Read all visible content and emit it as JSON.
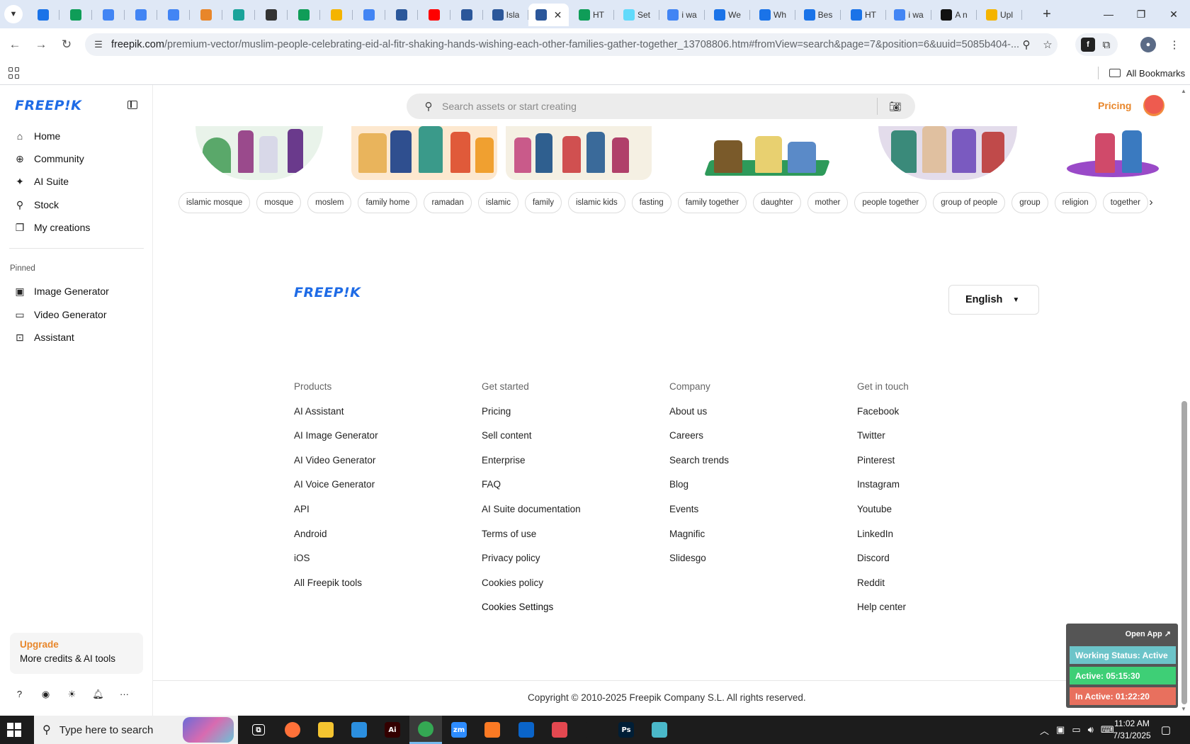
{
  "browser": {
    "tabs": [
      {
        "title": "",
        "color": "#1a73e8"
      },
      {
        "title": "",
        "color": "#0f9d58"
      },
      {
        "title": "",
        "color": "#4285f4"
      },
      {
        "title": "",
        "color": "#4285f4"
      },
      {
        "title": "",
        "color": "#4285f4"
      },
      {
        "title": "",
        "color": "#e8862a"
      },
      {
        "title": "",
        "color": "#1aa39a"
      },
      {
        "title": "",
        "color": "#333333"
      },
      {
        "title": "",
        "color": "#0f9d58"
      },
      {
        "title": "",
        "color": "#f4b400"
      },
      {
        "title": "",
        "color": "#4285f4"
      },
      {
        "title": "",
        "color": "#2b579a"
      },
      {
        "title": "",
        "color": "#ff0000"
      },
      {
        "title": "",
        "color": "#2b579a"
      },
      {
        "title": "Isla",
        "color": "#2b579a"
      },
      {
        "title": "",
        "color": "#2b579a",
        "active": true
      },
      {
        "title": "HT",
        "color": "#0f9d58"
      },
      {
        "title": "Set",
        "color": "#61dafb"
      },
      {
        "title": "i wa",
        "color": "#4285f4"
      },
      {
        "title": "We",
        "color": "#1a73e8"
      },
      {
        "title": "Wh",
        "color": "#1a73e8"
      },
      {
        "title": "Bes",
        "color": "#1a73e8"
      },
      {
        "title": "HT",
        "color": "#1a73e8"
      },
      {
        "title": "i wa",
        "color": "#4285f4"
      },
      {
        "title": "A n",
        "color": "#111111"
      },
      {
        "title": "Upl",
        "color": "#f4b400"
      }
    ],
    "url_host": "freepik.com",
    "url_path": "/premium-vector/muslim-people-celebrating-eid-al-fitr-shaking-hands-wishing-each-other-families-gather-together_13708806.htm#fromView=search&page=7&position=6&uuid=5085b404-...",
    "bookmarks_label": "All Bookmarks"
  },
  "sidebar": {
    "logo": "FREEP!K",
    "nav": [
      {
        "label": "Home",
        "icon": "⌂"
      },
      {
        "label": "Community",
        "icon": "⊕"
      },
      {
        "label": "AI Suite",
        "icon": "✦"
      },
      {
        "label": "Stock",
        "icon": "⚲"
      },
      {
        "label": "My creations",
        "icon": "❐"
      }
    ],
    "pinned_label": "Pinned",
    "pinned": [
      {
        "label": "Image Generator",
        "icon": "▣"
      },
      {
        "label": "Video Generator",
        "icon": "▭"
      },
      {
        "label": "Assistant",
        "icon": "⊡"
      }
    ],
    "upgrade_title": "Upgrade",
    "upgrade_sub": "More credits & AI tools"
  },
  "header": {
    "search_placeholder": "Search assets or start creating",
    "pricing": "Pricing"
  },
  "tags": [
    "islamic mosque",
    "mosque",
    "moslem",
    "family home",
    "ramadan",
    "islamic",
    "family",
    "islamic kids",
    "fasting",
    "family together",
    "daughter",
    "mother",
    "people together",
    "group of people",
    "group",
    "religion",
    "together"
  ],
  "footer": {
    "logo": "FREEP!K",
    "language": "English",
    "columns": [
      {
        "heading": "Products",
        "links": [
          "AI Assistant",
          "AI Image Generator",
          "AI Video Generator",
          "AI Voice Generator",
          "API",
          "Android",
          "iOS",
          "All Freepik tools"
        ]
      },
      {
        "heading": "Get started",
        "links": [
          "Pricing",
          "Sell content",
          "Enterprise",
          "FAQ",
          "AI Suite documentation",
          "Terms of use",
          "Privacy policy",
          "Cookies policy",
          "Cookies Settings"
        ]
      },
      {
        "heading": "Company",
        "links": [
          "About us",
          "Careers",
          "Search trends",
          "Blog",
          "Events",
          "Magnific",
          "Slidesgo"
        ]
      },
      {
        "heading": "Get in touch",
        "links": [
          "Facebook",
          "Twitter",
          "Pinterest",
          "Instagram",
          "Youtube",
          "LinkedIn",
          "Discord",
          "Reddit",
          "Help center"
        ]
      }
    ],
    "copyright": "Copyright © 2010-2025 Freepik Company S.L. All rights reserved."
  },
  "widget": {
    "open_app": "Open App ↗",
    "working_status": "Working Status: Active",
    "active": "Active: 05:15:30",
    "inactive": "In Active: 01:22:20",
    "colors": {
      "status": "#6cc4c9",
      "active": "#3ecf76",
      "inactive": "#e8705e"
    }
  },
  "taskbar": {
    "search_placeholder": "Type here to search",
    "apps": [
      {
        "name": "task-view",
        "label": "⧉",
        "color": "#1c1c1c"
      },
      {
        "name": "firefox",
        "label": "",
        "color": "#ff7139"
      },
      {
        "name": "file-explorer",
        "label": "",
        "color": "#f4c430"
      },
      {
        "name": "vscode",
        "label": "",
        "color": "#2b8fe0"
      },
      {
        "name": "illustrator",
        "label": "Ai",
        "color": "#330000"
      },
      {
        "name": "chrome",
        "label": "",
        "color": "#34a853",
        "active": true
      },
      {
        "name": "zoom",
        "label": "zm",
        "color": "#2d8cff"
      },
      {
        "name": "xampp",
        "label": "",
        "color": "#fb7a24"
      },
      {
        "name": "outlook",
        "label": "",
        "color": "#0a64c9"
      },
      {
        "name": "creative-cloud",
        "label": "",
        "color": "#e34850"
      },
      {
        "name": "pen-tool",
        "label": "",
        "color": "#1c1c1c"
      },
      {
        "name": "photoshop",
        "label": "Ps",
        "color": "#001e36"
      },
      {
        "name": "app-unknown",
        "label": "",
        "color": "#4ab8c9"
      }
    ],
    "time": "11:02 AM",
    "date": "7/31/2025"
  }
}
